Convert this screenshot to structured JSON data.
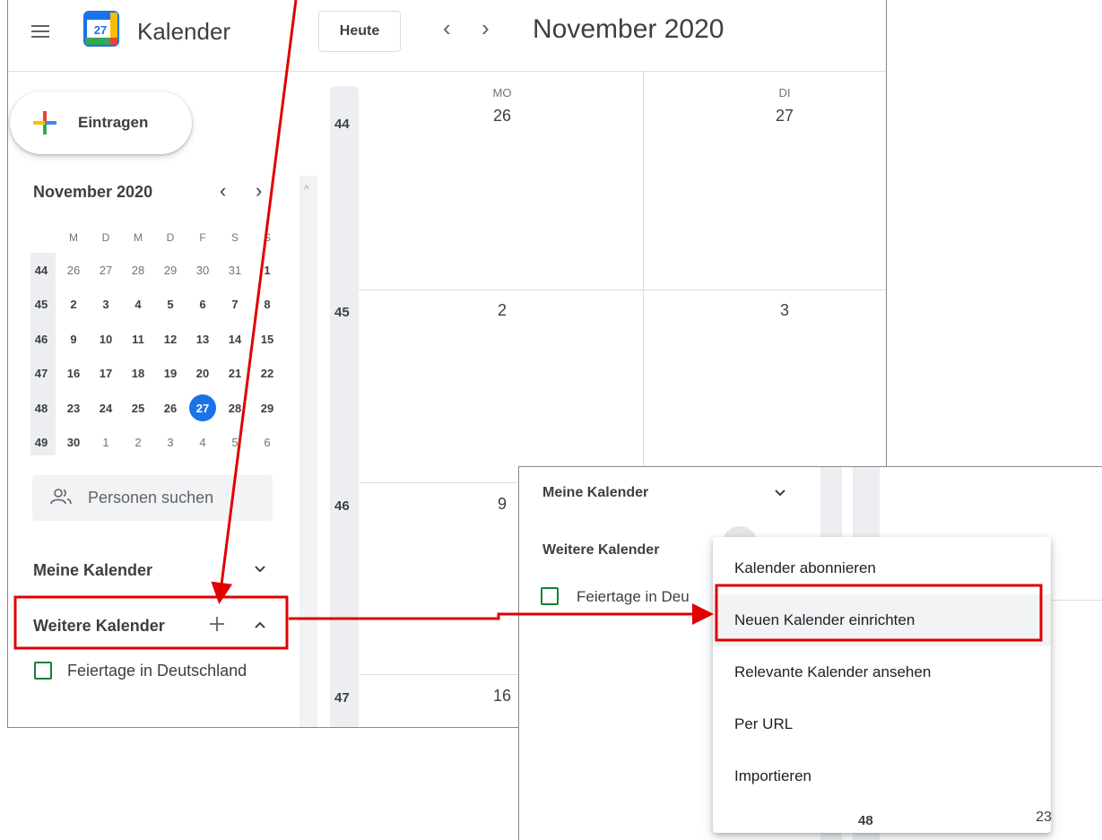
{
  "header": {
    "app_title": "Kalender",
    "logo_day": "27",
    "today_button": "Heute",
    "prev_arrow": "‹",
    "next_arrow": "›",
    "month_title": "November 2020"
  },
  "sidebar": {
    "create_label": "Eintragen",
    "mini_calendar": {
      "title": "November 2020",
      "prev": "‹",
      "next": "›",
      "weekday_headers": [
        "M",
        "D",
        "M",
        "D",
        "F",
        "S",
        "S"
      ],
      "weeks": [
        {
          "week": "44",
          "days": [
            "26",
            "27",
            "28",
            "29",
            "30",
            "31",
            "1"
          ]
        },
        {
          "week": "45",
          "days": [
            "2",
            "3",
            "4",
            "5",
            "6",
            "7",
            "8"
          ]
        },
        {
          "week": "46",
          "days": [
            "9",
            "10",
            "11",
            "12",
            "13",
            "14",
            "15"
          ]
        },
        {
          "week": "47",
          "days": [
            "16",
            "17",
            "18",
            "19",
            "20",
            "21",
            "22"
          ]
        },
        {
          "week": "48",
          "days": [
            "23",
            "24",
            "25",
            "26",
            "27",
            "28",
            "29"
          ]
        },
        {
          "week": "49",
          "days": [
            "30",
            "1",
            "2",
            "3",
            "4",
            "5",
            "6"
          ]
        }
      ],
      "today": "27"
    },
    "people_search_placeholder": "Personen suchen",
    "my_calendars_label": "Meine Kalender",
    "other_calendars_label": "Weitere Kalender",
    "other_calendars_items": [
      "Feiertage in Deutschland"
    ]
  },
  "grid": {
    "days": [
      {
        "weekday": "MO",
        "date": "26"
      },
      {
        "weekday": "DI",
        "date": "27"
      }
    ],
    "weeks": [
      {
        "week": "44",
        "mo": "26",
        "di": "27"
      },
      {
        "week": "45",
        "mo": "2",
        "di": "3"
      },
      {
        "week": "46",
        "mo": "9"
      },
      {
        "week": "47",
        "mo": "16"
      }
    ]
  },
  "overlay": {
    "my_calendars_label": "Meine Kalender",
    "other_calendars_label": "Weitere Kalender",
    "holiday_item": "Feiertage in Deu",
    "menu_items": [
      "Kalender abonnieren",
      "Neuen Kalender einrichten",
      "Relevante Kalender ansehen",
      "Per URL",
      "Importieren"
    ],
    "highlighted_item": "Neuen Kalender einrichten",
    "grid_week": "48",
    "grid_date": "23"
  },
  "colors": {
    "accent_blue": "#1a73e8",
    "annotation_red": "#e00000",
    "checkbox_green": "#188038"
  }
}
